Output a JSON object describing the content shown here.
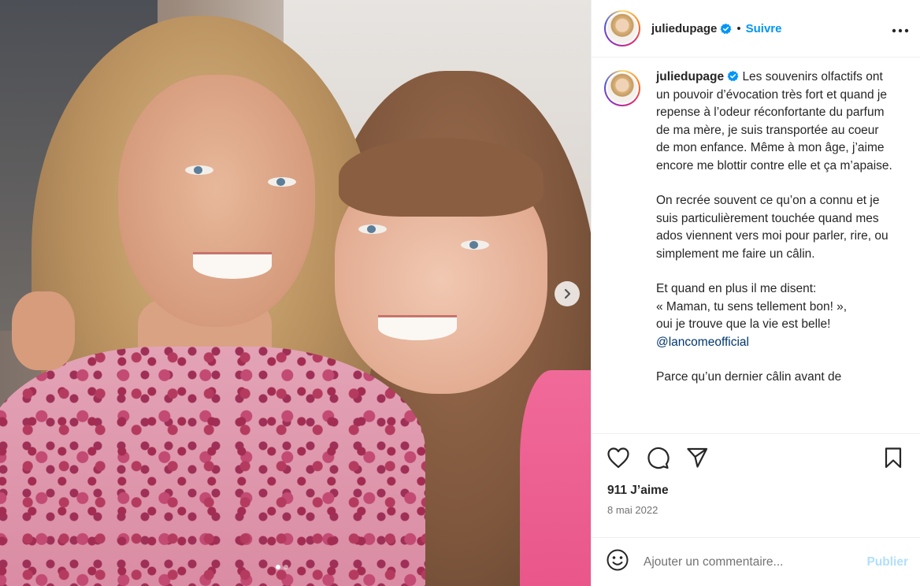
{
  "post": {
    "author": "juliedupage",
    "follow_label": "Suivre",
    "separator": "•",
    "more_label": "•••"
  },
  "caption": {
    "username": "juliedupage",
    "para1": "Les souvenirs olfactifs ont un pouvoir d’évocation très fort et quand je repense à l’odeur réconfortante du parfum de ma mère, je suis transportée au coeur de mon enfance. Même à mon âge, j’aime encore me blottir contre elle et ça m’apaise.",
    "para2": "On recrée souvent ce qu’on a connu et je suis particulièrement touchée quand mes ados viennent vers moi pour parler, rire, ou simplement me faire un câlin.",
    "para3_line1": "Et quand en plus il me disent:",
    "para3_line2": "« Maman, tu sens tellement bon! »,",
    "para3_line3": "oui je trouve que la vie est belle!",
    "mention": "@lancomeofficial",
    "para4": "Parce qu’un dernier câlin avant de"
  },
  "stats": {
    "likes": "911 J’aime",
    "date": "8 mai 2022"
  },
  "comment": {
    "placeholder": "Ajouter un commentaire...",
    "post_label": "Publier"
  },
  "carousel": {
    "slide_count": 2,
    "active_index": 0
  },
  "icons": {
    "heart": "heart-icon",
    "comment": "comment-icon",
    "share": "share-icon",
    "bookmark": "bookmark-icon",
    "emoji": "emoji-icon",
    "verified": "verified-badge-icon",
    "next": "chevron-right-icon"
  },
  "colors": {
    "link_blue": "#0095f6",
    "mention": "#00376b",
    "muted": "#737373",
    "disabled_post": "#b2dffc"
  }
}
